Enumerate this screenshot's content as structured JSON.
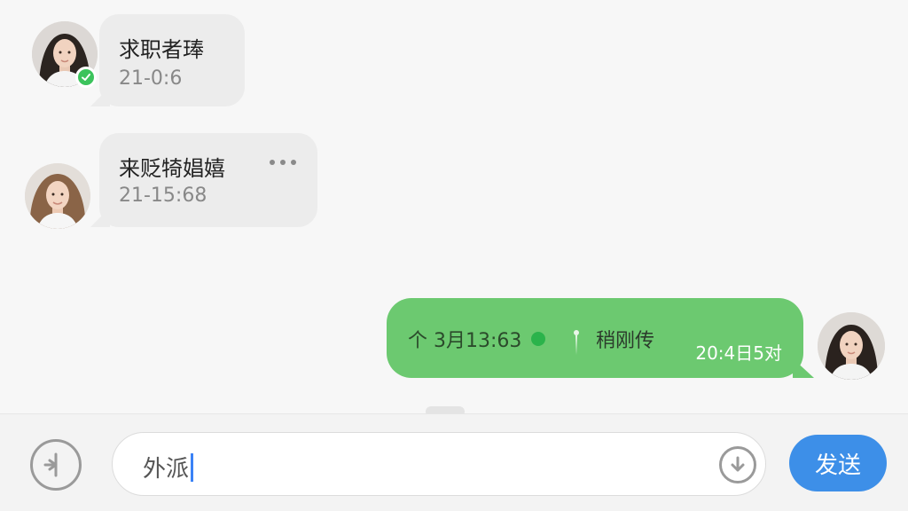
{
  "conversation": {
    "messages_in": [
      {
        "name": "求职者琫",
        "time": "21-0:6",
        "verified": true
      },
      {
        "name": "来贬犄娼嬉",
        "time": "21-15:68",
        "verified": false
      }
    ],
    "message_out": {
      "text": "个 3月13:63",
      "label": "稍刚传",
      "meta": "20:4日5对"
    }
  },
  "input_bar": {
    "input_value": "外派",
    "send_label": "发送"
  },
  "icons": {
    "voice": "voice-icon",
    "emoji": "emoji-icon",
    "verified": "check-icon",
    "more": "more-icon"
  },
  "colors": {
    "outgoing_bubble": "#6cc970",
    "incoming_bubble": "#ececec",
    "send_button": "#3d8fe8",
    "verified_badge": "#3cc35c",
    "caret": "#3b82f6"
  }
}
